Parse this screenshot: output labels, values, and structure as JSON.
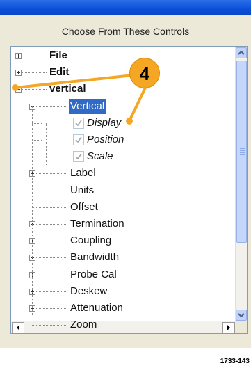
{
  "heading": "Choose From These Controls",
  "tree": [
    {
      "label": "File",
      "expander": "plus",
      "depth": 0,
      "bold": true
    },
    {
      "label": "Edit",
      "expander": "plus",
      "depth": 0,
      "bold": true
    },
    {
      "label": "vertical",
      "expander": "minus",
      "depth": 0,
      "bold": true
    },
    {
      "label": "Vertical",
      "expander": "minus",
      "depth": 1,
      "selected": true
    },
    {
      "label": "Display",
      "check": true,
      "depth": 2,
      "italic": true
    },
    {
      "label": "Position",
      "check": true,
      "depth": 2,
      "italic": true
    },
    {
      "label": "Scale",
      "check": true,
      "depth": 2,
      "italic": true
    },
    {
      "label": "Label",
      "expander": "plus",
      "depth": 1
    },
    {
      "label": "Units",
      "depth": 1
    },
    {
      "label": "Offset",
      "depth": 1
    },
    {
      "label": "Termination",
      "expander": "plus",
      "depth": 1
    },
    {
      "label": "Coupling",
      "expander": "plus",
      "depth": 1
    },
    {
      "label": "Bandwidth",
      "expander": "plus",
      "depth": 1
    },
    {
      "label": "Probe Cal",
      "expander": "plus",
      "depth": 1
    },
    {
      "label": "Deskew",
      "expander": "plus",
      "depth": 1
    },
    {
      "label": "Attenuation",
      "expander": "plus",
      "depth": 1
    },
    {
      "label": "Zoom",
      "depth": 1
    }
  ],
  "callout": {
    "number": "4",
    "color": "#f5a623"
  },
  "figure_id": "1733-143",
  "colors": {
    "selection": "#316ac5",
    "titlebar": "#0b4fd9",
    "panel": "#ece9d8"
  },
  "icons": {
    "scroll_up": "triangle-up-icon",
    "scroll_down": "triangle-down-icon",
    "scroll_left": "triangle-left-icon",
    "scroll_right": "triangle-right-icon",
    "expand": "plus-box-icon",
    "collapse": "minus-box-icon",
    "checked": "check-icon"
  }
}
